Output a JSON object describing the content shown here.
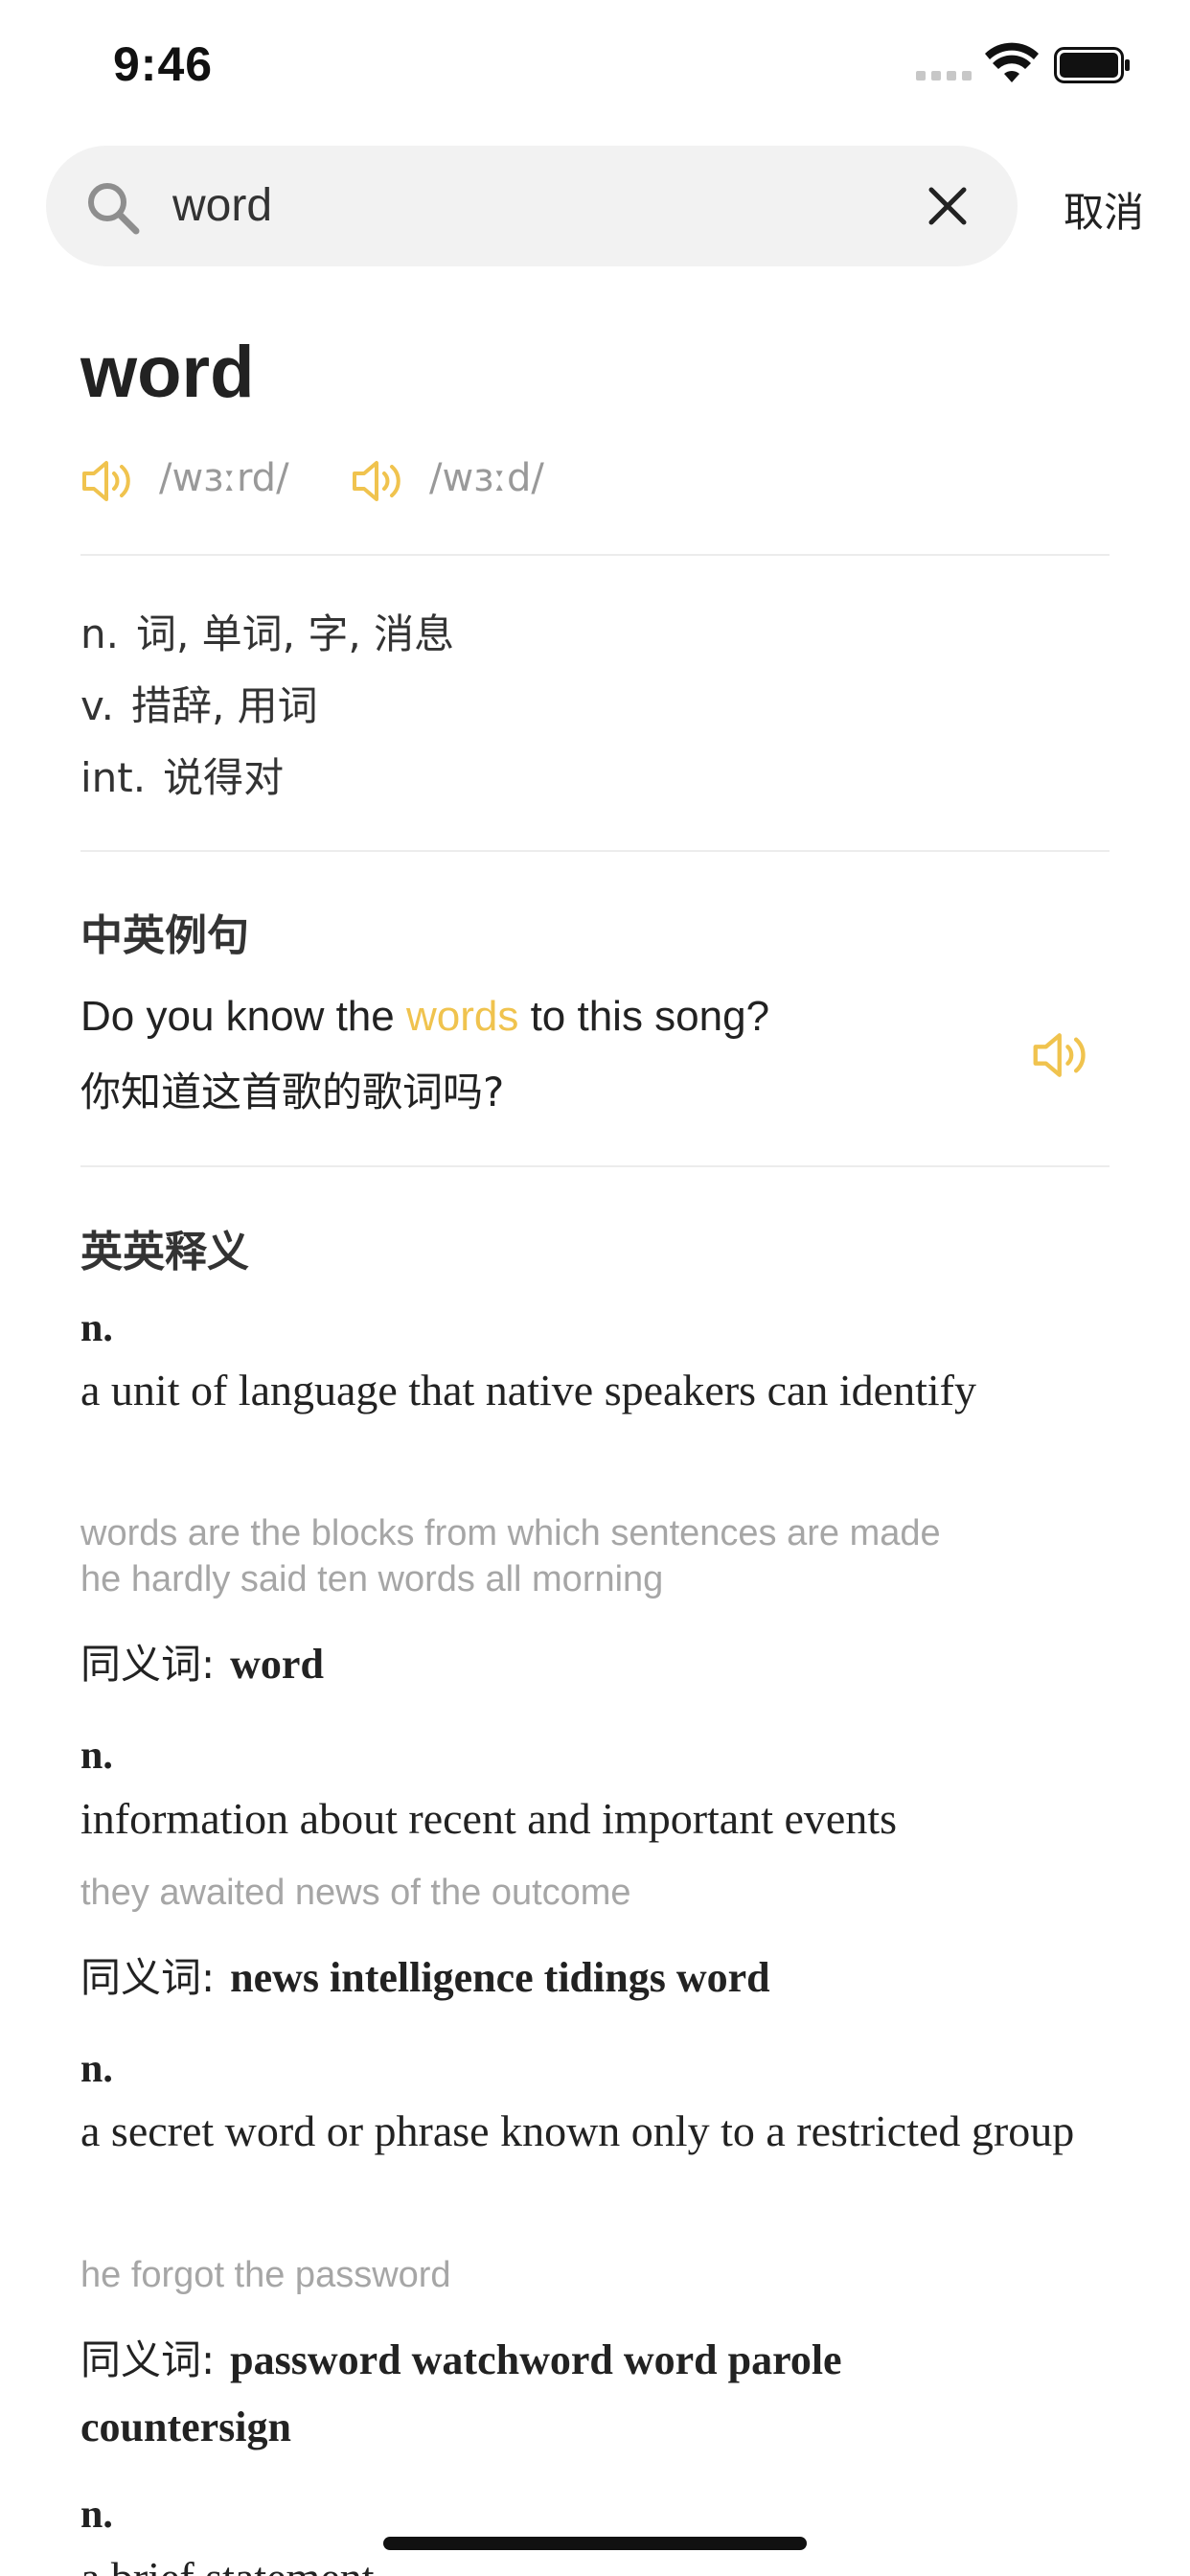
{
  "status_bar": {
    "time": "9:46"
  },
  "search": {
    "value": "word",
    "cancel_label": "取消"
  },
  "entry": {
    "word": "word",
    "pronunciations": [
      {
        "phonetic": "/wɜːrd/"
      },
      {
        "phonetic": "/wɜːd/"
      }
    ],
    "definitions": [
      {
        "pos": "n.",
        "meaning": "词, 单词, 字, 消息"
      },
      {
        "pos": "v.",
        "meaning": "措辞, 用词"
      },
      {
        "pos": "int.",
        "meaning": "说得对"
      }
    ]
  },
  "examples_section": {
    "title": "中英例句",
    "sentence_before": "Do you know the ",
    "sentence_highlight": "words",
    "sentence_after": " to this song?",
    "translation": "你知道这首歌的歌词吗?"
  },
  "english_section": {
    "title": "英英释义",
    "synonym_label": "同义词:",
    "senses": [
      {
        "pos": "n.",
        "definition": "a unit of language that native speakers can identify",
        "examples": [
          "words are the blocks from which sentences are made",
          "he hardly said ten words all morning"
        ],
        "synonyms": "word"
      },
      {
        "pos": "n.",
        "definition": "information about recent and important events",
        "examples": [
          "they awaited news of the outcome"
        ],
        "synonyms": "news intelligence tidings word"
      },
      {
        "pos": "n.",
        "definition": "a secret word or phrase known only to a restricted group",
        "examples": [
          "he forgot the password"
        ],
        "synonyms": "password watchword word parole countersign"
      },
      {
        "pos": "n.",
        "definition": "a brief statement"
      }
    ]
  },
  "colors": {
    "accent": "#f0c34e",
    "secondary_text": "#999999",
    "divider": "#ececec",
    "search_bg": "#f2f2f2"
  }
}
